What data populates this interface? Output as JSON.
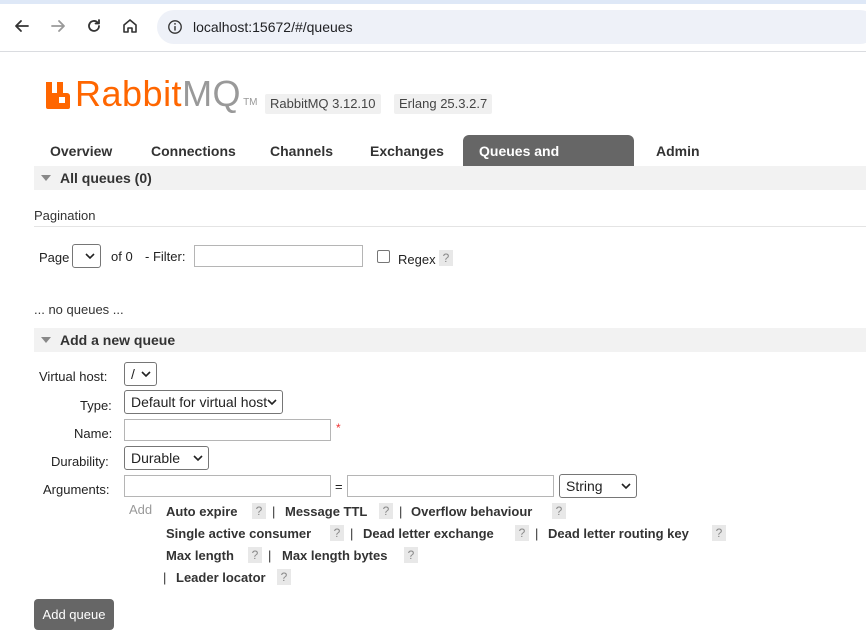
{
  "browser": {
    "url": "localhost:15672/#/queues"
  },
  "header": {
    "logo_rabbit": "Rabbit",
    "logo_mq": "MQ",
    "logo_tm": "TM",
    "version": "RabbitMQ 3.12.10",
    "erlang": "Erlang 25.3.2.7"
  },
  "tabs": [
    {
      "label": "Overview"
    },
    {
      "label": "Connections"
    },
    {
      "label": "Channels"
    },
    {
      "label": "Exchanges"
    },
    {
      "label": "Queues and Streams",
      "active": true
    },
    {
      "label": "Admin"
    }
  ],
  "all_queues": {
    "title": "All queues (0)",
    "pagination_label": "Pagination",
    "page_label": "Page",
    "of_label": "of 0",
    "filter_label": "- Filter:",
    "filter_value": "",
    "regex_label": "Regex",
    "help": "?",
    "empty_text": "... no queues ..."
  },
  "add_queue": {
    "title": "Add a new queue",
    "virtual_host_label": "Virtual host:",
    "virtual_host_value": "/",
    "type_label": "Type:",
    "type_value": "Default for virtual host",
    "name_label": "Name:",
    "name_value": "",
    "required_mark": "*",
    "durability_label": "Durability:",
    "durability_value": "Durable",
    "arguments_label": "Arguments:",
    "equals": "=",
    "arg_type_value": "String",
    "add_label": "Add",
    "arg_links": [
      "Auto expire",
      "Message TTL",
      "Overflow behaviour",
      "Single active consumer",
      "Dead letter exchange",
      "Dead letter routing key",
      "Max length",
      "Max length bytes",
      "Leader locator"
    ],
    "separator": "|",
    "submit_label": "Add queue"
  },
  "colors": {
    "brand_orange": "#ff6600",
    "brand_gray": "#999999",
    "tab_active": "#666666",
    "section_bg": "#f2f2f2"
  }
}
